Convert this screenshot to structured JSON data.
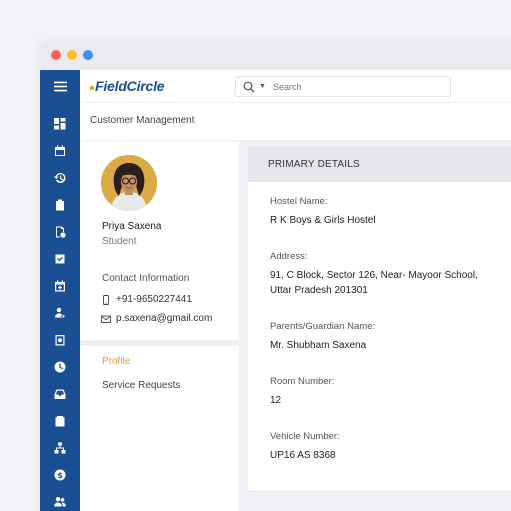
{
  "app": {
    "brand": "FieldCircle",
    "search_placeholder": "Search",
    "breadcrumb": "Customer Management",
    "accent_color": "#1b4f93",
    "highlight_color": "#f39a1c"
  },
  "sidebar": {
    "icons": [
      "menu-icon",
      "dashboard-icon",
      "calendar-icon",
      "history-icon",
      "clipboard-icon",
      "document-settings-icon",
      "checkbox-icon",
      "calendar-add-icon",
      "user-transfer-icon",
      "receipt-icon",
      "clock-icon",
      "inbox-icon",
      "checklist-icon",
      "hierarchy-icon",
      "dollar-icon",
      "users-icon"
    ]
  },
  "profile": {
    "name": "Priya Saxena",
    "role": "Student",
    "contact_title": "Contact Information",
    "phone": "+91-9650227441",
    "email": "p.saxena@gmail.com"
  },
  "nav": {
    "items": [
      {
        "label": "Profile"
      },
      {
        "label": "Service Requests"
      }
    ]
  },
  "details": {
    "header": "PRIMARY DETAILS",
    "fields": [
      {
        "label": "Hostel  Name:",
        "value": "R K Boys & Girls Hostel"
      },
      {
        "label": "Address:",
        "value": "91, C Block, Sector 126, Near- Mayoor School, Uttar Pradesh 201301"
      },
      {
        "label": "Parents/Guardian Name:",
        "value": "Mr. Shubham Saxena"
      },
      {
        "label": "Room Number:",
        "value": "12"
      },
      {
        "label": "Vehicle Number:",
        "value": "UP16 AS 8368"
      }
    ]
  }
}
